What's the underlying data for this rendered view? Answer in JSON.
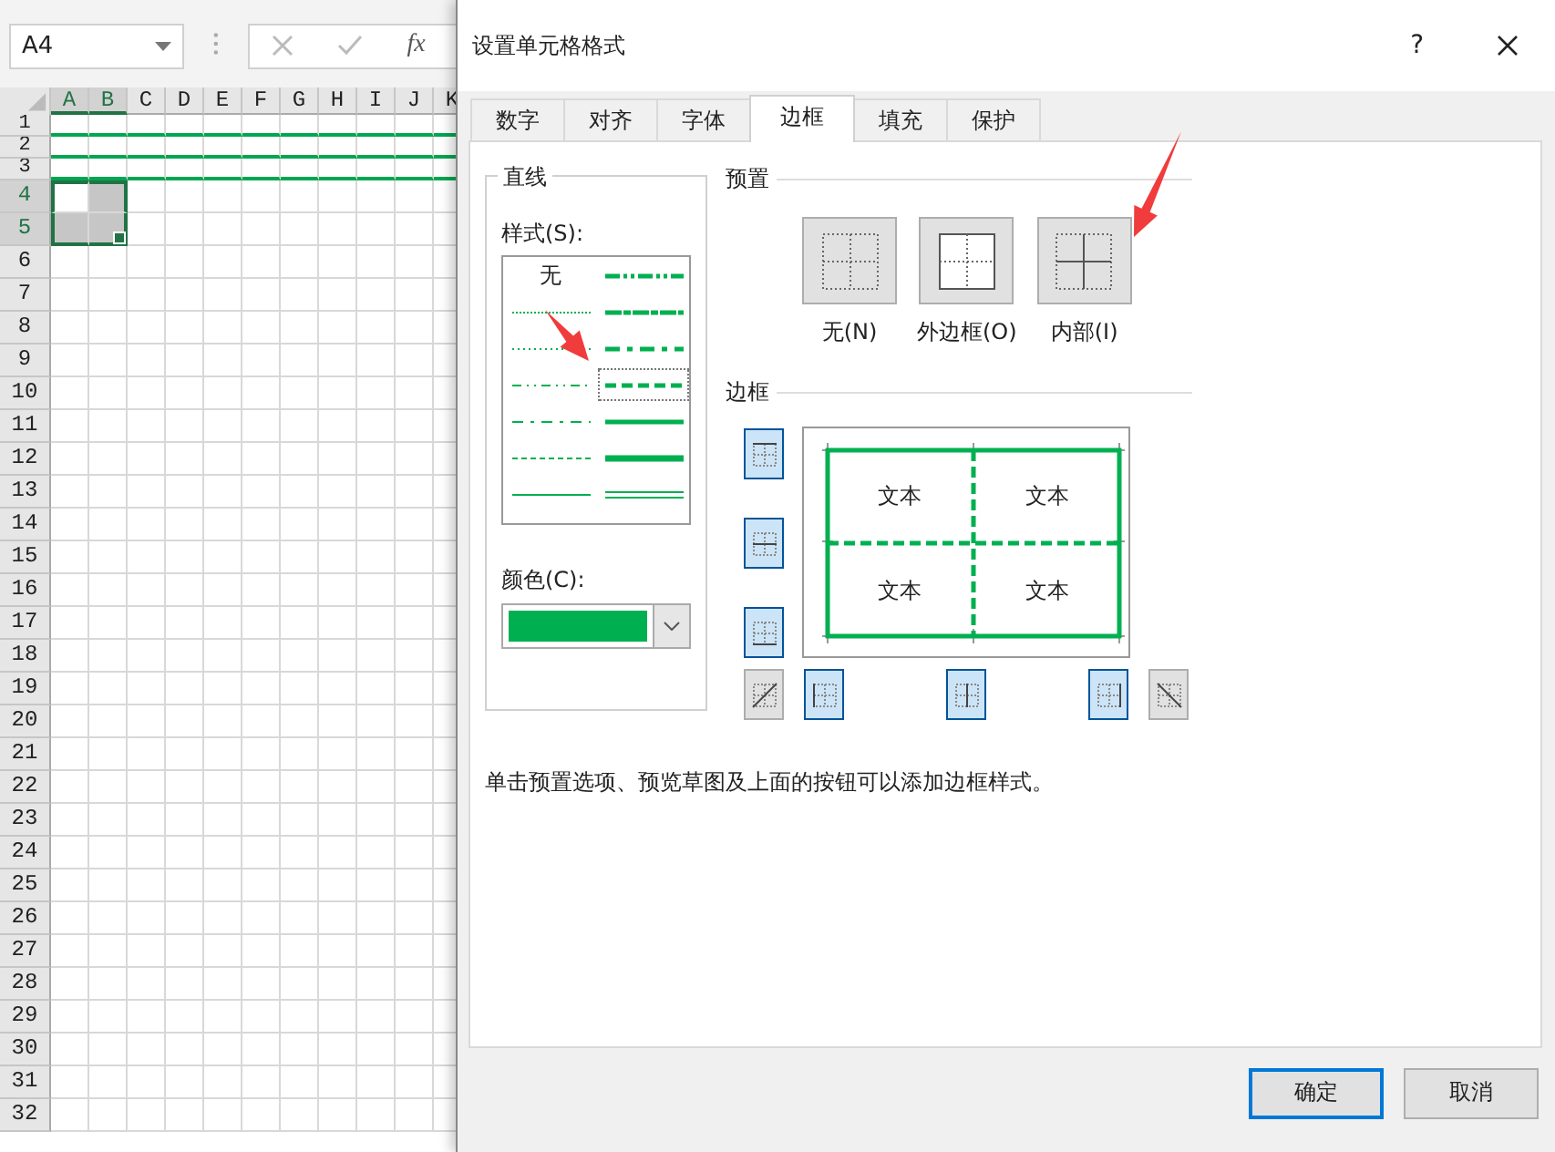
{
  "spreadsheet": {
    "name_box": "A4",
    "function_label": "fx",
    "columns": [
      {
        "label": "A",
        "selected": true
      },
      {
        "label": "B",
        "selected": true
      },
      {
        "label": "C",
        "selected": false
      },
      {
        "label": "D",
        "selected": false
      },
      {
        "label": "E",
        "selected": false
      },
      {
        "label": "F",
        "selected": false
      },
      {
        "label": "G",
        "selected": false
      },
      {
        "label": "H",
        "selected": false
      },
      {
        "label": "I",
        "selected": false
      },
      {
        "label": "J",
        "selected": false
      },
      {
        "label": "K",
        "selected": false
      }
    ],
    "rows": [
      {
        "label": "1",
        "selected": false,
        "bottom_border": true
      },
      {
        "label": "2",
        "selected": false,
        "bottom_border": true
      },
      {
        "label": "3",
        "selected": false,
        "bottom_border": true
      },
      {
        "label": "4",
        "selected": true,
        "bottom_border": false,
        "shaded": [
          false,
          true
        ]
      },
      {
        "label": "5",
        "selected": true,
        "bottom_border": false,
        "shaded": [
          true,
          true
        ]
      },
      {
        "label": "6",
        "selected": false,
        "bottom_border": false
      },
      {
        "label": "7",
        "selected": false,
        "bottom_border": false
      },
      {
        "label": "8",
        "selected": false,
        "bottom_border": false
      },
      {
        "label": "9",
        "selected": false,
        "bottom_border": false
      },
      {
        "label": "10",
        "selected": false,
        "bottom_border": false
      },
      {
        "label": "11",
        "selected": false,
        "bottom_border": false
      },
      {
        "label": "12",
        "selected": false,
        "bottom_border": false
      },
      {
        "label": "13",
        "selected": false,
        "bottom_border": false
      },
      {
        "label": "14",
        "selected": false,
        "bottom_border": false
      },
      {
        "label": "15",
        "selected": false,
        "bottom_border": false
      },
      {
        "label": "16",
        "selected": false,
        "bottom_border": false
      },
      {
        "label": "17",
        "selected": false,
        "bottom_border": false
      },
      {
        "label": "18",
        "selected": false,
        "bottom_border": false
      },
      {
        "label": "19",
        "selected": false,
        "bottom_border": false
      },
      {
        "label": "20",
        "selected": false,
        "bottom_border": false
      },
      {
        "label": "21",
        "selected": false,
        "bottom_border": false
      },
      {
        "label": "22",
        "selected": false,
        "bottom_border": false
      },
      {
        "label": "23",
        "selected": false,
        "bottom_border": false
      },
      {
        "label": "24",
        "selected": false,
        "bottom_border": false
      },
      {
        "label": "25",
        "selected": false,
        "bottom_border": false
      },
      {
        "label": "26",
        "selected": false,
        "bottom_border": false
      },
      {
        "label": "27",
        "selected": false,
        "bottom_border": false
      },
      {
        "label": "28",
        "selected": false,
        "bottom_border": false
      },
      {
        "label": "29",
        "selected": false,
        "bottom_border": false
      },
      {
        "label": "30",
        "selected": false,
        "bottom_border": false
      },
      {
        "label": "31",
        "selected": false,
        "bottom_border": false
      },
      {
        "label": "32",
        "selected": false,
        "bottom_border": false
      }
    ]
  },
  "dialog": {
    "title": "设置单元格格式",
    "help": "?",
    "tabs": [
      {
        "label": "数字",
        "selected": false
      },
      {
        "label": "对齐",
        "selected": false
      },
      {
        "label": "字体",
        "selected": false
      },
      {
        "label": "边框",
        "selected": true
      },
      {
        "label": "填充",
        "selected": false
      },
      {
        "label": "保护",
        "selected": false
      }
    ],
    "line": {
      "title": "直线",
      "style_label": "样式(S):",
      "color_label": "颜色(C):",
      "color": "#00b050",
      "styles": [
        {
          "kind": "none",
          "label": "无",
          "selected": false
        },
        {
          "kind": "hair",
          "selected": false
        },
        {
          "kind": "dotted",
          "selected": false
        },
        {
          "kind": "dash_dot_dot",
          "selected": false
        },
        {
          "kind": "dash_dot",
          "selected": false
        },
        {
          "kind": "dashed",
          "selected": false
        },
        {
          "kind": "thin",
          "selected": false
        },
        {
          "kind": "medium_dash_dot_dot",
          "selected": false
        },
        {
          "kind": "slanted_dash_dot",
          "selected": false
        },
        {
          "kind": "medium_dash_dot",
          "selected": false
        },
        {
          "kind": "medium_dashed",
          "selected": true
        },
        {
          "kind": "medium",
          "selected": false
        },
        {
          "kind": "thick",
          "selected": false
        },
        {
          "kind": "double",
          "selected": false
        }
      ]
    },
    "presets": {
      "title": "预置",
      "items": [
        {
          "kind": "none",
          "label": "无(N)"
        },
        {
          "kind": "outline",
          "label": "外边框(O)"
        },
        {
          "kind": "inside",
          "label": "内部(I)"
        }
      ]
    },
    "border": {
      "title": "边框",
      "preview_texts": [
        "文本",
        "文本",
        "文本",
        "文本"
      ],
      "side_buttons": [
        {
          "kind": "top",
          "on": true
        },
        {
          "kind": "middle",
          "on": true
        },
        {
          "kind": "bottom",
          "on": true
        }
      ],
      "bottom_buttons": [
        {
          "kind": "diagonal_up",
          "on": false
        },
        {
          "kind": "left",
          "on": true
        },
        {
          "kind": "center",
          "on": true
        },
        {
          "kind": "right",
          "on": true
        },
        {
          "kind": "diagonal_down",
          "on": false
        }
      ]
    },
    "hint": "单击预置选项、预览草图及上面的按钮可以添加边框样式。",
    "buttons": [
      {
        "label": "确定",
        "default": true
      },
      {
        "label": "取消",
        "default": false
      }
    ]
  }
}
